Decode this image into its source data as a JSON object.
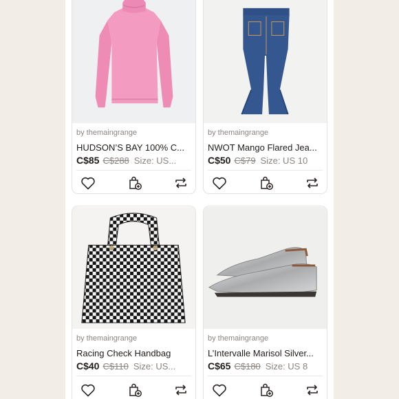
{
  "listings": [
    {
      "seller": "by themaingrange",
      "title": "HUDSON’S BAY 100% C...",
      "price": "C$85",
      "original_price": "C$288",
      "size": "Size: US...",
      "image": "pink-turtleneck-sweater"
    },
    {
      "seller": "by themaingrange",
      "title": "NWOT Mango Flared Jea...",
      "price": "C$50",
      "original_price": "C$79",
      "size": "Size: US 10",
      "image": "flared-jeans"
    },
    {
      "seller": "by themaingrange",
      "title": "Racing Check Handbag",
      "price": "C$40",
      "original_price": "C$110",
      "size": "Size: US...",
      "image": "checkered-handbag"
    },
    {
      "seller": "by themaingrange",
      "title": "L’Intervalle Marisol Silver...",
      "price": "C$65",
      "original_price": "C$180",
      "size": "Size: US 8",
      "image": "silver-loafers"
    }
  ],
  "icons": {
    "like": "heart-icon",
    "bundle": "shopping-bag-plus-icon",
    "share": "share-icon"
  },
  "colors": {
    "background": "#f3ede7",
    "card": "#ffffff",
    "text": "#1f1b19",
    "muted": "#8a8480"
  }
}
